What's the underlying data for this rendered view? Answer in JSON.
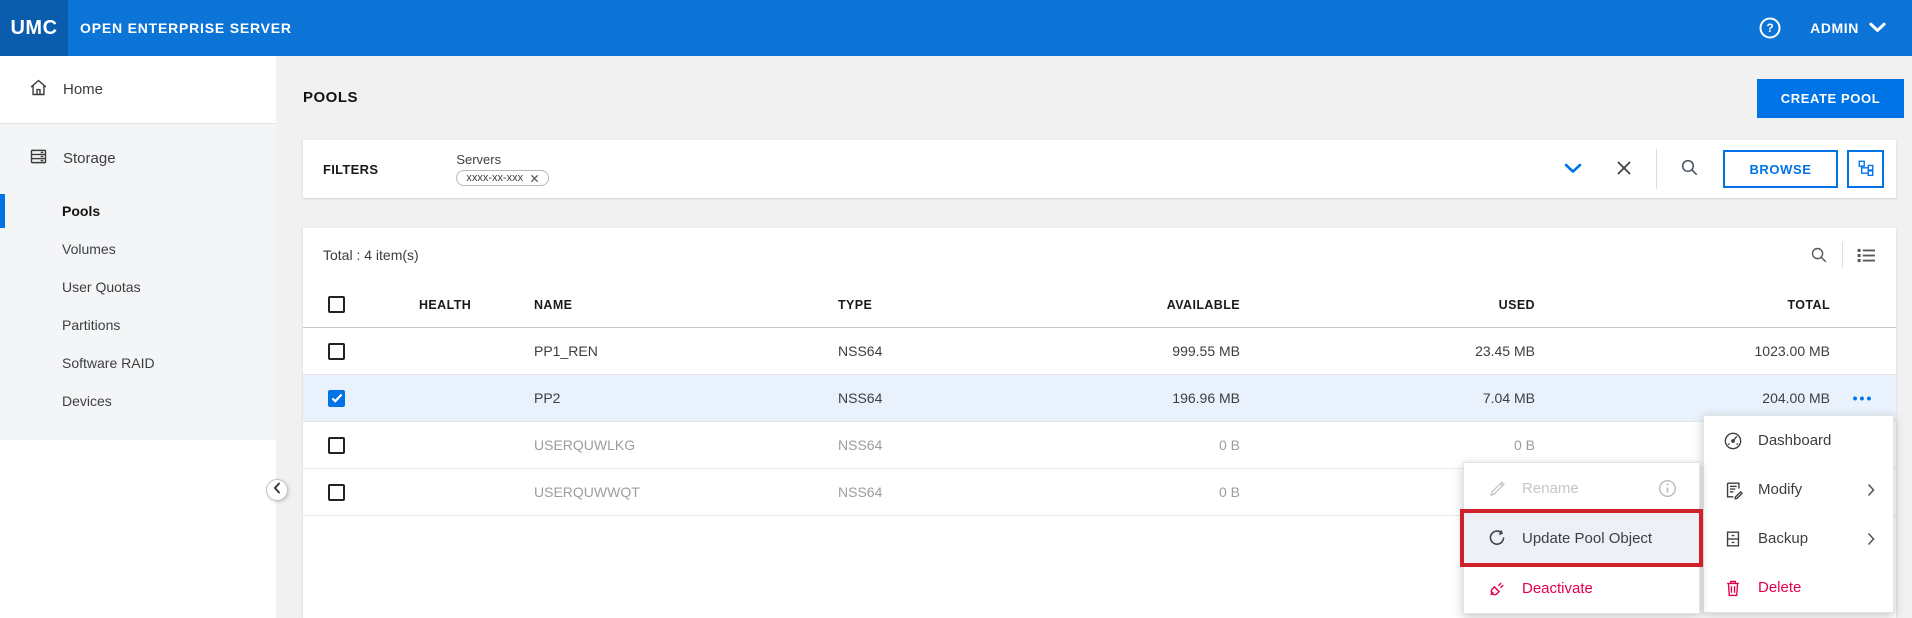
{
  "topbar": {
    "brand": "UMC",
    "product": "OPEN ENTERPRISE SERVER",
    "user_menu": "ADMIN",
    "help_icon": "help-circle-icon"
  },
  "sidebar": {
    "home": {
      "label": "Home",
      "icon": "home-icon"
    },
    "storage": {
      "label": "Storage",
      "icon": "storage-icon",
      "items": [
        {
          "label": "Pools",
          "selected": true
        },
        {
          "label": "Volumes"
        },
        {
          "label": "User Quotas"
        },
        {
          "label": "Partitions"
        },
        {
          "label": "Software RAID"
        },
        {
          "label": "Devices"
        }
      ]
    },
    "collapse_icon": "chevron-left-icon"
  },
  "page": {
    "title": "POOLS",
    "create_button": "CREATE POOL"
  },
  "filter_bar": {
    "label": "FILTERS",
    "group_label": "Servers",
    "chip": "xxxx-xx-xxx",
    "chip_remove_icon": "x-icon",
    "collapse_icon": "chevron-down-icon",
    "clear_icon": "x-icon",
    "search_icon": "search-icon",
    "browse_button": "BROWSE",
    "tree_icon": "object-tree-icon"
  },
  "table": {
    "total_text": "Total : 4 item(s)",
    "search_icon": "search-icon",
    "density_icon": "list-view-icon",
    "columns": {
      "health": "HEALTH",
      "name": "NAME",
      "type": "TYPE",
      "available": "AVAILABLE",
      "used": "USED",
      "total": "TOTAL"
    },
    "rows": [
      {
        "name": "PP1_REN",
        "type": "NSS64",
        "available": "999.55 MB",
        "used": "23.45 MB",
        "total": "1023.00 MB",
        "health": "active",
        "checked": false
      },
      {
        "name": "PP2",
        "type": "NSS64",
        "available": "196.96 MB",
        "used": "7.04 MB",
        "total": "204.00 MB",
        "health": "active",
        "checked": true,
        "selected": true
      },
      {
        "name": "USERQUWLKG",
        "type": "NSS64",
        "available": "0 B",
        "used": "0 B",
        "total": "",
        "health": "inactive",
        "checked": false
      },
      {
        "name": "USERQUWWQT",
        "type": "NSS64",
        "available": "0 B",
        "used": "",
        "total": "",
        "health": "inactive",
        "checked": false
      }
    ],
    "row_actions_icon": "ellipsis-icon",
    "row_actions_glyph": "•••"
  },
  "context_menu": {
    "items": [
      {
        "label": "Dashboard",
        "icon": "gauge-icon"
      },
      {
        "label": "Modify",
        "icon": "edit-document-icon",
        "has_submenu": true
      },
      {
        "label": "Backup",
        "icon": "backup-cabinet-icon",
        "has_submenu": true
      },
      {
        "label": "Delete",
        "icon": "trash-icon",
        "danger": true
      }
    ]
  },
  "submenu": {
    "items": [
      {
        "label": "Rename",
        "icon": "pencil-icon",
        "disabled": true,
        "info_icon": "info-icon"
      },
      {
        "label": "Update Pool Object",
        "icon": "refresh-icon",
        "highlighted": true
      },
      {
        "label": "Deactivate",
        "icon": "unplug-icon",
        "danger": true
      }
    ]
  },
  "colors": {
    "topbar": "#0b74d6",
    "brand_block": "#0a5cac",
    "accent": "#0073e7",
    "selected_row": "#e8f1fc",
    "health_active": "#26a84d",
    "health_inactive": "#c9cbcd",
    "danger_pink": "#e5004c",
    "highlight_red": "#d0202a"
  }
}
